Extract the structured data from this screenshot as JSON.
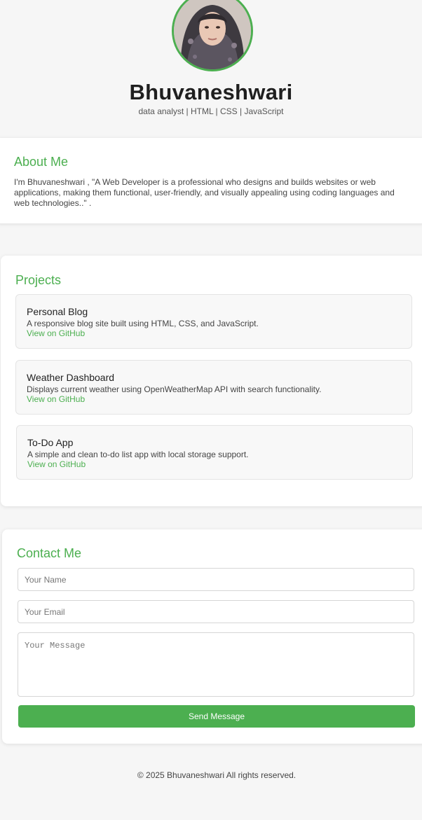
{
  "header": {
    "name": "Bhuvaneshwari",
    "tagline": "data analyst | HTML | CSS | JavaScript"
  },
  "about": {
    "title": "About Me",
    "text": "I'm Bhuvaneshwari , \"A Web Developer is a professional who designs and builds websites or web applications, making them functional, user-friendly, and visually appealing using coding languages and web technologies..\" ."
  },
  "projects": {
    "title": "Projects",
    "items": [
      {
        "title": "Personal Blog",
        "description": "A responsive blog site built using HTML, CSS, and JavaScript.",
        "link": "View on GitHub"
      },
      {
        "title": "Weather Dashboard",
        "description": "Displays current weather using OpenWeatherMap API with search functionality.",
        "link": "View on GitHub"
      },
      {
        "title": "To-Do App",
        "description": "A simple and clean to-do list app with local storage support.",
        "link": "View on GitHub"
      }
    ]
  },
  "contact": {
    "title": "Contact Me",
    "name_placeholder": "Your Name",
    "email_placeholder": "Your Email",
    "message_placeholder": "Your Message",
    "send_label": "Send Message"
  },
  "footer": {
    "text": "© 2025 Bhuvaneshwari All rights reserved."
  },
  "colors": {
    "accent": "#4caf50",
    "background": "#f6f6f6"
  }
}
